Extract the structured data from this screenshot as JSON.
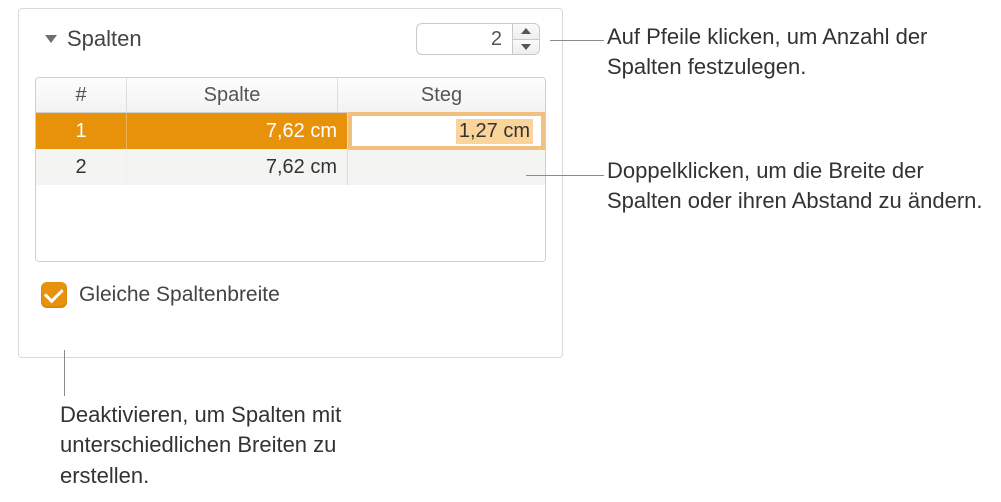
{
  "panel": {
    "title": "Spalten",
    "column_count": "2",
    "equal_width_label": "Gleiche Spaltenbreite",
    "equal_width_checked": true
  },
  "table": {
    "headers": {
      "num": "#",
      "width": "Spalte",
      "gutter": "Steg"
    },
    "rows": [
      {
        "num": "1",
        "width": "7,62 cm",
        "gutter": "1,27 cm",
        "selected": true,
        "editing": true
      },
      {
        "num": "2",
        "width": "7,62 cm",
        "gutter": "",
        "selected": false,
        "editing": false
      }
    ]
  },
  "callouts": {
    "stepper": "Auf Pfeile klicken, um Anzahl der Spalten festzulegen.",
    "cell": "Doppelklicken, um die Breite der Spalten oder ihren Abstand zu ändern.",
    "checkbox": "Deaktivieren, um Spalten mit unterschiedlichen Breiten zu erstellen."
  },
  "icons": {
    "disclosure": "disclosure-down",
    "stepper_up": "arrow-up",
    "stepper_down": "arrow-down",
    "check": "checkmark"
  }
}
